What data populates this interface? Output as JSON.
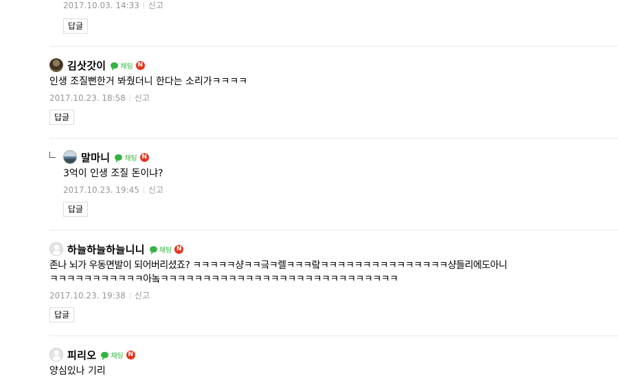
{
  "top_partial": {
    "date": "2017.10.03. 14:33",
    "report": "신고",
    "reply": "답글"
  },
  "comments": [
    {
      "nickname": "김삿갓이",
      "chat": "채팅",
      "badge": "N",
      "text": "인생 조질뻔한거 봐줬더니 한다는 소리가ㅋㅋㅋㅋ",
      "date": "2017.10.23. 18:58",
      "report": "신고",
      "reply": "답글"
    },
    {
      "nickname": "말마니",
      "chat": "채팅",
      "badge": "N",
      "text": "3억이 인생 조질 돈이냐?",
      "date": "2017.10.23. 19:45",
      "report": "신고",
      "reply": "답글"
    },
    {
      "nickname": "하늘하늘하늘니니",
      "chat": "채팅",
      "badge": "N",
      "text_line1": "존나 뇌가 우동면발이 되어버리셨죠? ㅋㅋㅋㅋㅋ샹ㅋㅋ긐ㅋ렐ㅋㅋㅋ랔ㅋㅋㅋㅋㅋㅋㅋㅋㅋㅋㅋㅋㅋㅋㅋ샹들리에도아니",
      "text_line2": "ㅋㅋㅋㅋㅋㅋㅋㅋㅋㅋㅋ아놐ㅋㅋㅋㅋㅋㅋㅋㅋㅋㅋㅋㅋㅋㅋㅋㅋㅋㅋㅋㅋㅋㅋㅋㅋㅋㅋㅋㅋ",
      "date": "2017.10.23. 19:38",
      "report": "신고",
      "reply": "답글"
    },
    {
      "nickname": "피리오",
      "chat": "채팅",
      "badge": "N",
      "text": "양심있나 기리"
    }
  ]
}
